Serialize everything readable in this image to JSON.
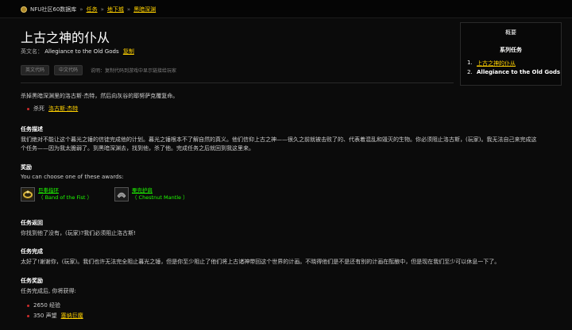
{
  "breadcrumb": {
    "home": "NFU社区60数据库",
    "items": [
      "任务",
      "地下城",
      "黑暗深渊"
    ]
  },
  "title": "上古之神的仆从",
  "english": {
    "label": "英文名：",
    "name": "Allegiance to the Old Gods",
    "copy": "复制"
  },
  "buttons": {
    "en_code": "英文代码",
    "cn_code": "中文代码",
    "note": "说明：复制代码到游戏中显示链接给玩家"
  },
  "summary": {
    "title": "概要",
    "series_title": "系列任务",
    "series": [
      {
        "num": "1.",
        "label": "上古之神的仆从"
      },
      {
        "num": "2.",
        "label": "Allegiance to the Old Gods"
      }
    ]
  },
  "objective": {
    "text": "杀掉黑暗深渊里的洛古斯·杰特，然后向灰谷的耶努萨克覆复命。",
    "bullet_prefix": "杀死",
    "bullet_link": "洛古斯·杰特"
  },
  "description": {
    "heading": "任务描述",
    "line1": "我们绝对不能让这个暮光之锤的信徒完成他的计划。暮光之锤根本不了解自然的真义。他们信仰上古之神——很久之前就被击败了的、代表着混乱和毁灭的生物。你必须阻止洛古斯，(玩家)。我无法自己来完成这",
    "line2": "个任务——因为我太脆弱了。到黑暗深渊去，找到他，杀了他。完成任务之后就回到我这里来。"
  },
  "rewards": {
    "heading": "奖励",
    "choose": "You can choose one of these awards:",
    "items": [
      {
        "name": "巨拳指环",
        "en": "（ Band of the Fist ）",
        "icon": "ring-icon"
      },
      {
        "name": "栗壳护肩",
        "en": "（ Chestnut Mantle ）",
        "icon": "shoulder-icon"
      }
    ]
  },
  "return": {
    "heading": "任务返回",
    "text": "你找到他了没有，(玩家)?我们必须阻止洛古斯!"
  },
  "complete": {
    "heading": "任务完成",
    "text": "太好了!谢谢你，(玩家)。我们也许无法完全阻止暮光之锤，但是你至少阻止了他们将上古诸神带回这个世界的计画。不晓得他们是不是还有别的计画在酝酿中，但是现在我们至少可以休息一下了。"
  },
  "quest_reward": {
    "heading": "任务奖励",
    "intro": "任务完成后, 你将获得:",
    "xp": "2650 经验",
    "rep_prefix": "350 声望",
    "rep_link": "塞纳巨魔"
  },
  "colors": {
    "link": "#ffd100",
    "item_link": "#1eff00",
    "bullet": "#cc2b2b",
    "background": "#0b0b0b"
  }
}
